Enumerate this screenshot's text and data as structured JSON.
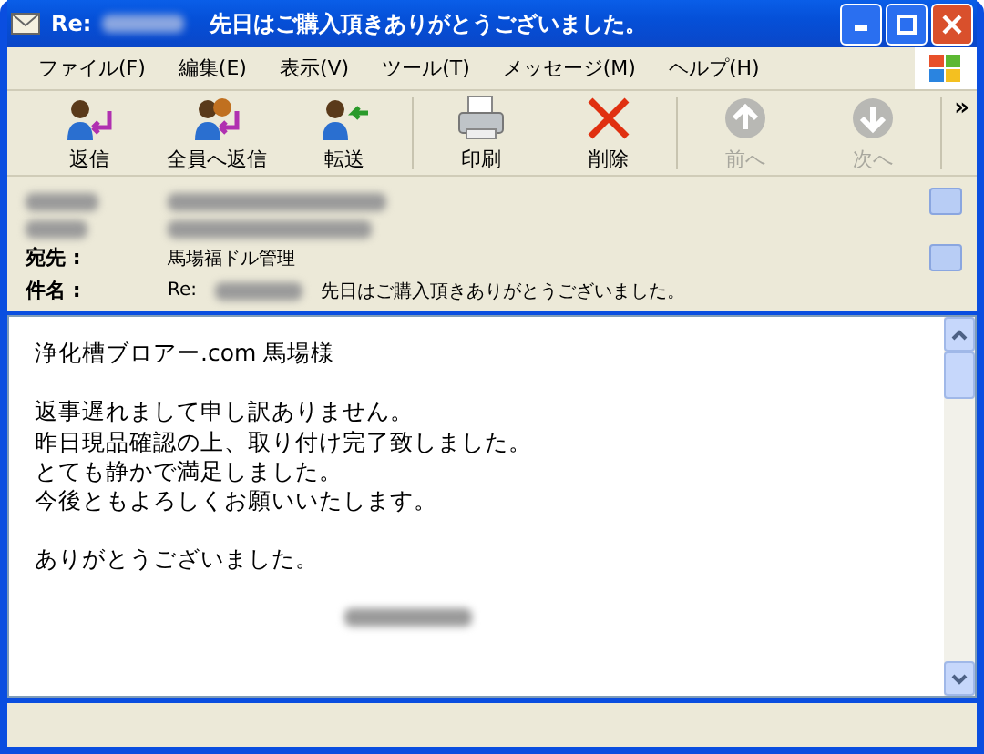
{
  "window": {
    "title_prefix": "Re:",
    "title": "先日はご購入頂きありがとうございました。"
  },
  "menu": [
    "ファイル(F)",
    "編集(E)",
    "表示(V)",
    "ツール(T)",
    "メッセージ(M)",
    "ヘルプ(H)"
  ],
  "toolbar": [
    {
      "kind": "reply",
      "label": "返信",
      "disabled": false
    },
    {
      "kind": "reply_all",
      "label": "全員へ返信",
      "disabled": false
    },
    {
      "kind": "forward",
      "label": "転送",
      "disabled": false
    },
    {
      "kind": "print",
      "label": "印刷",
      "disabled": false
    },
    {
      "kind": "delete",
      "label": "削除",
      "disabled": false
    },
    {
      "kind": "prev",
      "label": "前へ",
      "disabled": true
    },
    {
      "kind": "next",
      "label": "次へ",
      "disabled": true
    }
  ],
  "toolbar_overflow": "»",
  "header": {
    "to_label": "宛先 :",
    "to": "馬場福ドル管理",
    "subject_label": "件名 :",
    "subject_prefix": "Re:",
    "subject": "先日はご購入頂きありがとうございました。"
  },
  "body": [
    [
      "浄化槽ブロアー.com 馬場様"
    ],
    [
      "返事遅れまして申し訳ありません。",
      "昨日現品確認の上、取り付け完了致しました。",
      "とても静かで満足しました。",
      "今後ともよろしくお願いいたします。"
    ],
    [
      "ありがとうございました。"
    ]
  ]
}
